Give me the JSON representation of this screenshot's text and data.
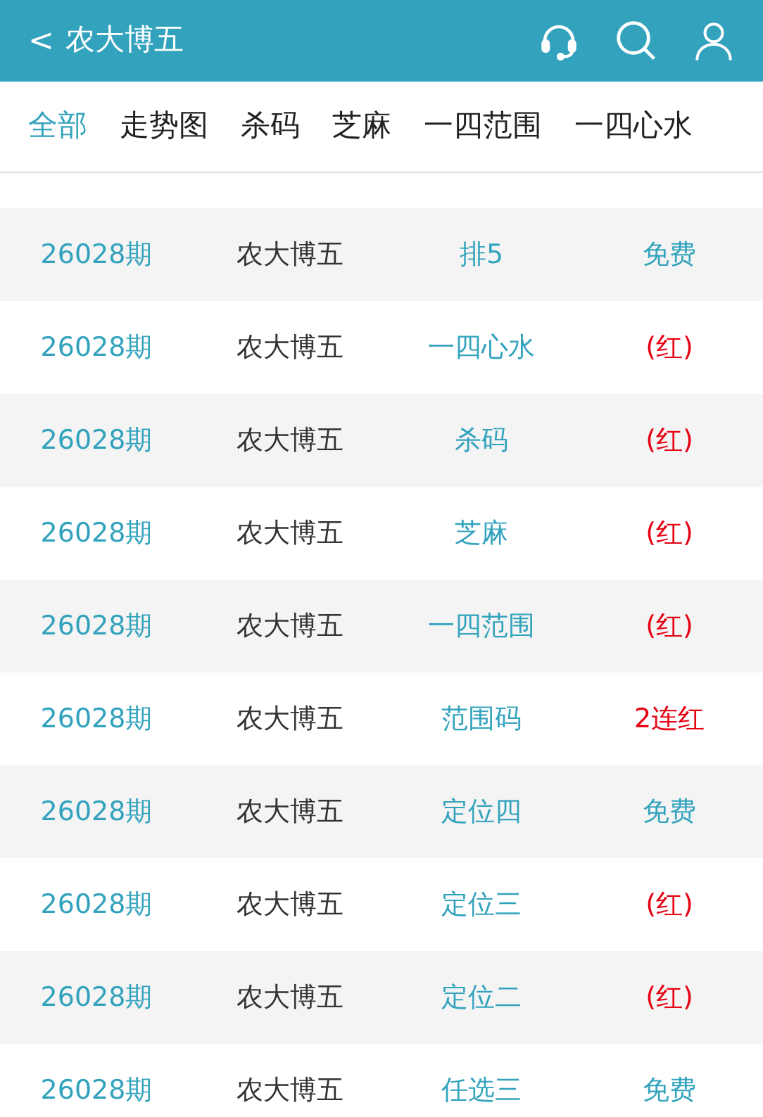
{
  "header": {
    "back": "<",
    "title": "农大博五"
  },
  "tabs": [
    {
      "label": "全部",
      "selected": true
    },
    {
      "label": "走势图",
      "selected": false
    },
    {
      "label": "杀码",
      "selected": false
    },
    {
      "label": "芝麻",
      "selected": false
    },
    {
      "label": "一四范围",
      "selected": false
    },
    {
      "label": "一四心水",
      "selected": false
    }
  ],
  "rows": [
    {
      "period": "26028期",
      "expert": "农大博五",
      "type": "排5",
      "result": "免费",
      "kind": "free"
    },
    {
      "period": "26028期",
      "expert": "农大博五",
      "type": "一四心水",
      "result": "(红)",
      "kind": "hit"
    },
    {
      "period": "26028期",
      "expert": "农大博五",
      "type": "杀码",
      "result": "(红)",
      "kind": "hit"
    },
    {
      "period": "26028期",
      "expert": "农大博五",
      "type": "芝麻",
      "result": "(红)",
      "kind": "hit"
    },
    {
      "period": "26028期",
      "expert": "农大博五",
      "type": "一四范围",
      "result": "(红)",
      "kind": "hit"
    },
    {
      "period": "26028期",
      "expert": "农大博五",
      "type": "范围码",
      "result": "2连红",
      "kind": "hit"
    },
    {
      "period": "26028期",
      "expert": "农大博五",
      "type": "定位四",
      "result": "免费",
      "kind": "free"
    },
    {
      "period": "26028期",
      "expert": "农大博五",
      "type": "定位三",
      "result": "(红)",
      "kind": "hit"
    },
    {
      "period": "26028期",
      "expert": "农大博五",
      "type": "定位二",
      "result": "(红)",
      "kind": "hit"
    },
    {
      "period": "26028期",
      "expert": "农大博五",
      "type": "任选三",
      "result": "免费",
      "kind": "free"
    }
  ]
}
